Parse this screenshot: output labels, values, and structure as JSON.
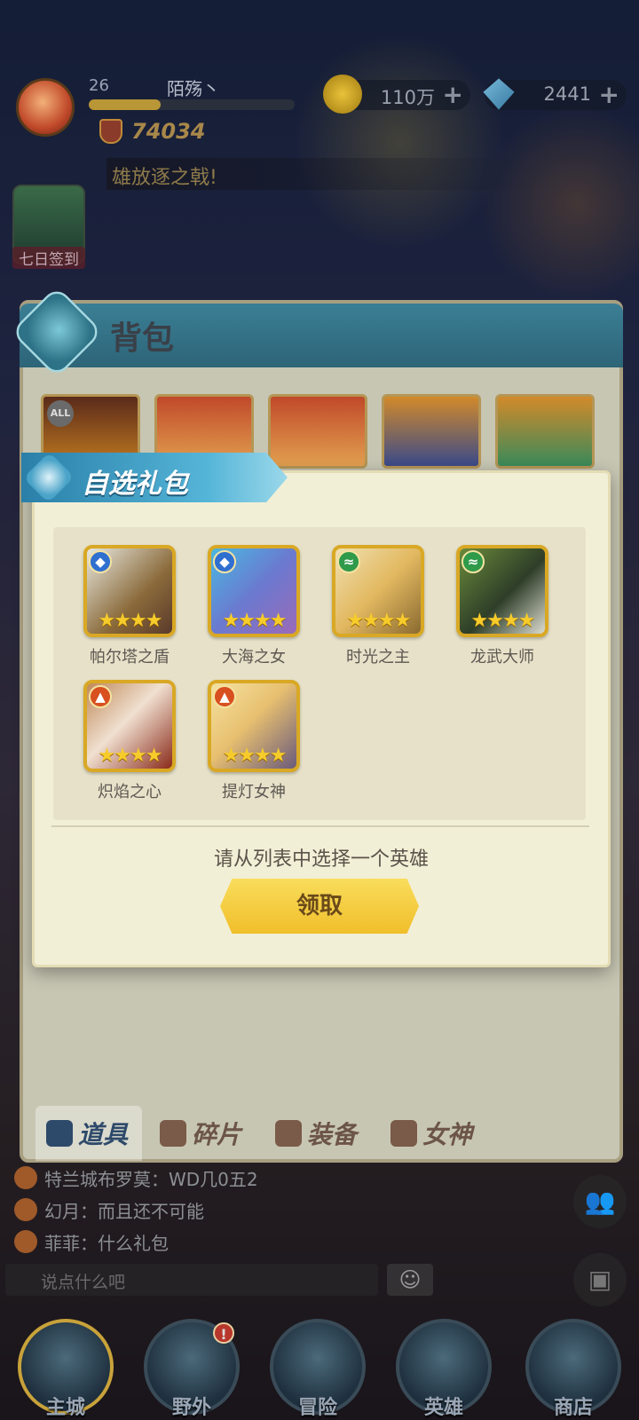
{
  "player": {
    "level": "26",
    "name": "陌殇丶",
    "xp_progress": 0.35,
    "power": "74034"
  },
  "currency": {
    "gold": "110万",
    "gems": "2441"
  },
  "marquee": "雄放逐之戟!",
  "signin": "七日签到",
  "bag": {
    "title": "背包",
    "slot_badge": "ALL",
    "tabs": [
      "道具",
      "碎片",
      "装备",
      "女神"
    ]
  },
  "modal": {
    "title": "自选礼包",
    "heroes": [
      {
        "name": "帕尔塔之盾",
        "element": "water",
        "stars": "★★★★"
      },
      {
        "name": "大海之女",
        "element": "water",
        "stars": "★★★★"
      },
      {
        "name": "时光之主",
        "element": "wind",
        "stars": "★★★★"
      },
      {
        "name": "龙武大师",
        "element": "wind",
        "stars": "★★★★"
      },
      {
        "name": "炽焰之心",
        "element": "fire",
        "stars": "★★★★"
      },
      {
        "name": "提灯女神",
        "element": "fire",
        "stars": "★★★★"
      }
    ],
    "prompt": "请从列表中选择一个英雄",
    "claim_label": "领取"
  },
  "chat": {
    "lines": [
      "特兰城布罗莫：WD几0五2",
      "幻月：而且还不可能",
      "菲菲：什么礼包"
    ],
    "placeholder": "说点什么吧"
  },
  "nav": {
    "items": [
      "主城",
      "野外",
      "冒险",
      "英雄",
      "商店"
    ],
    "badge": "!"
  },
  "colors": {
    "water": "#2f6fd0",
    "wind": "#2f9a4a",
    "fire": "#d8501f",
    "accent": "#f0be2a"
  }
}
